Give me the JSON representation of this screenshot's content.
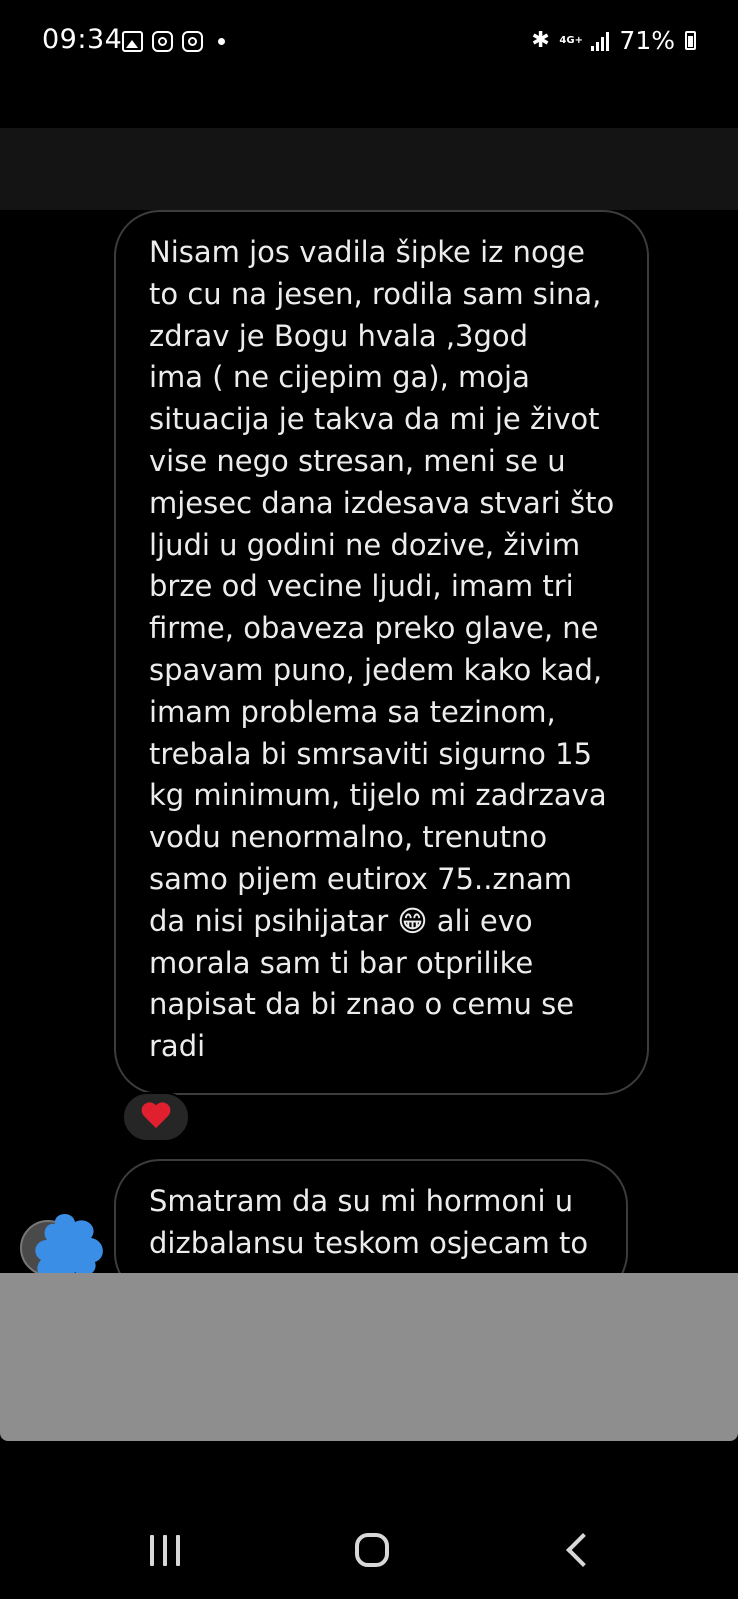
{
  "status_bar": {
    "time": "09:34",
    "notification_icons": [
      "gallery-icon",
      "instagram-icon",
      "instagram-icon",
      "dot-icon"
    ],
    "bluetooth_icon": "bluetooth-icon",
    "network_type": "4G+",
    "signal_icon": "signal-icon",
    "battery_percent": "71%"
  },
  "conversation": {
    "messages": [
      {
        "text": "Nisam jos vadila šipke iz noge\nto cu na jesen, rodila sam sina,\nzdrav je Bogu hvala ,3god\nima ( ne cijepim ga), moja\nsituacija je takva da mi je život\nvise nego stresan, meni se u\nmjesec dana izdesava stvari što\nljudi u godini ne dozive, živim\nbrze od vecine ljudi, imam tri\nfirme, obaveza preko glave, ne\nspavam puno, jedem kako kad,\nimam problema sa tezinom,\ntrebala bi smrsaviti sigurno 15\nkg minimum, tijelo mi zadrzava\nvodu nenormalno, trenutno\nsamo pijem eutirox 75..znam\nda nisi psihijatar 😁 ali evo\nmorala sam ti bar otprilike\nnapisat da bi znao o cemu se\nradi",
        "reaction": "heart-icon"
      },
      {
        "text": "Smatram da su mi hormoni u\ndizbalansu teskom osjecam to"
      }
    ],
    "sender_avatar": "avatar"
  },
  "colors": {
    "background": "#000000",
    "bubble_border": "#3c3c3c",
    "header_strip": "#141414",
    "composer_panel": "#8e8e8e",
    "reaction_heart": "#e0202e",
    "scribble": "#3a8ee6"
  },
  "nav_bar": {
    "recents_icon": "recents-icon",
    "home_icon": "home-icon",
    "back_icon": "back-icon"
  }
}
